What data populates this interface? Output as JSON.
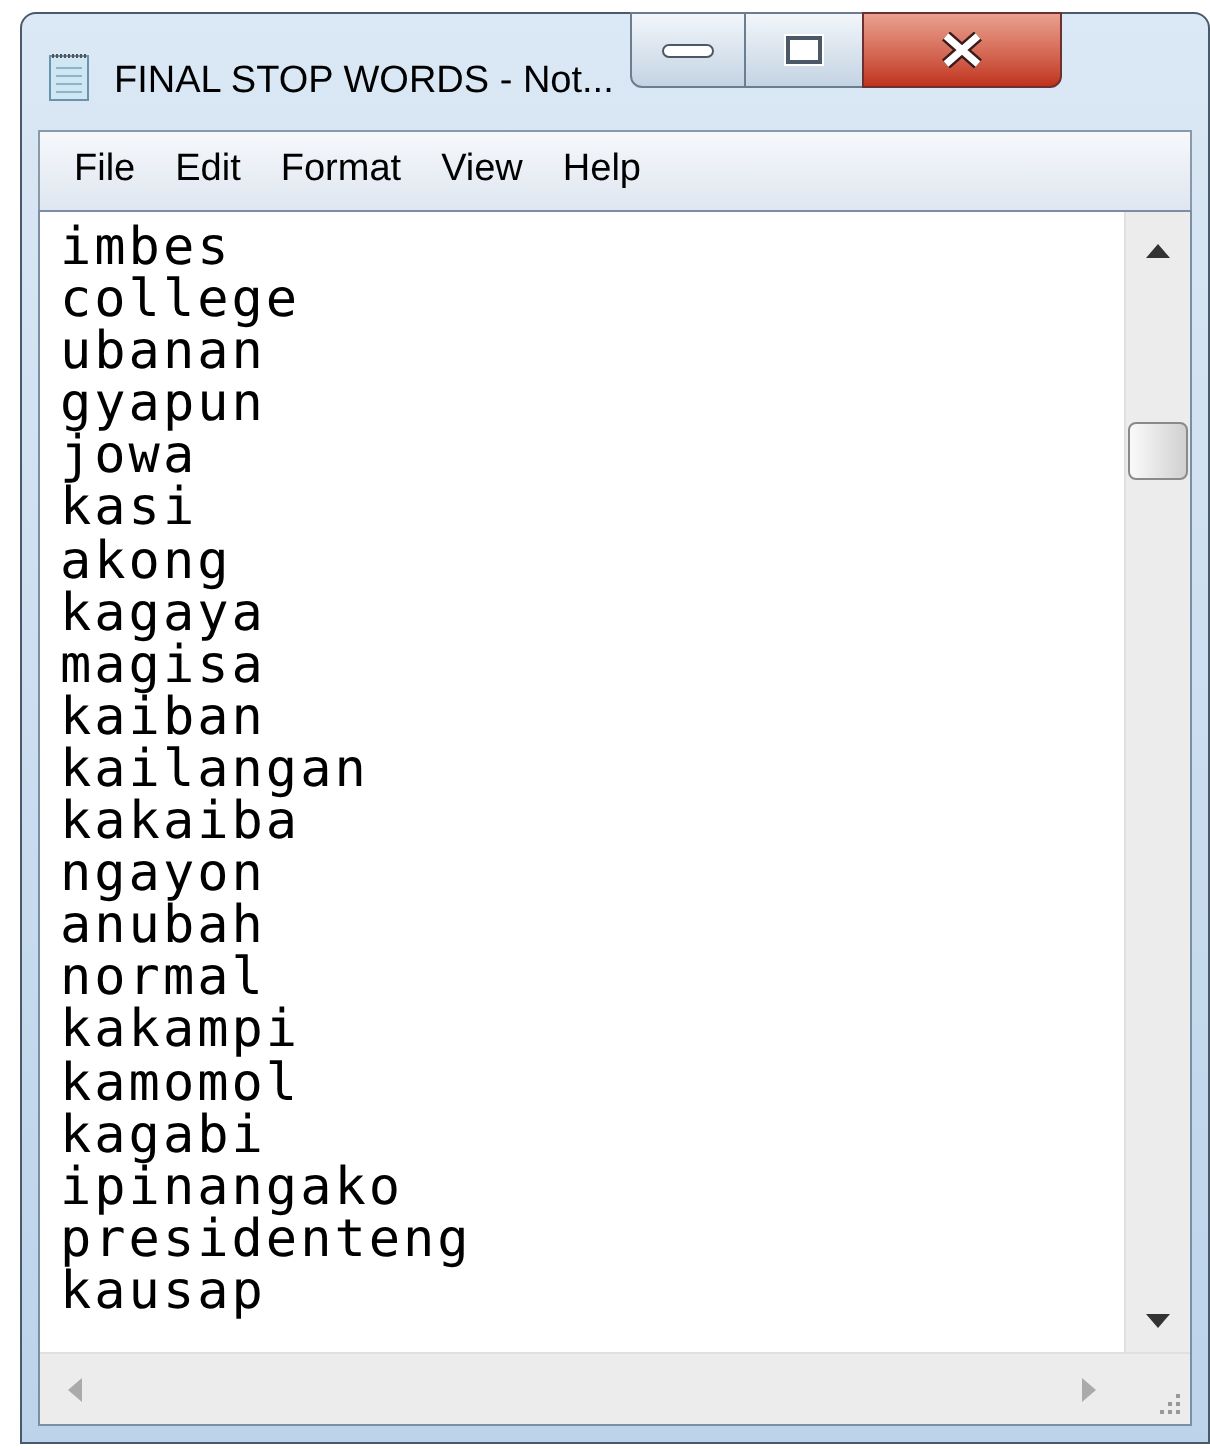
{
  "window": {
    "title": "FINAL STOP WORDS - Not..."
  },
  "menu": [
    "File",
    "Edit",
    "Format",
    "View",
    "Help"
  ],
  "editor": {
    "lines": [
      "imbes",
      "college",
      "ubanan",
      "gyapun",
      "jowa",
      "kasi",
      "akong",
      "kagaya",
      "magisa",
      "kaiban",
      "kailangan",
      "kakaiba",
      "ngayon",
      "anubah",
      "normal",
      "kakampi",
      "kamomol",
      "kagabi",
      "ipinangako",
      "presidenteng",
      "kausap"
    ]
  }
}
